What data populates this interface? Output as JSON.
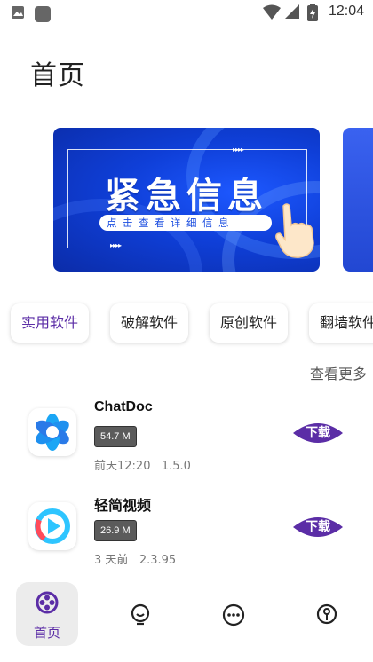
{
  "status_bar": {
    "time": "12:04",
    "left_icons": [
      "image-icon",
      "app-square-icon"
    ],
    "right_icons": [
      "wifi-icon",
      "signal-icon",
      "battery-charging-icon"
    ]
  },
  "page": {
    "title": "首页"
  },
  "banner": {
    "headline": "紧急信息",
    "subtitle": "点击查看详细信息",
    "arrows": "▸▸▸▸"
  },
  "categories": [
    {
      "label": "实用软件",
      "active": true
    },
    {
      "label": "破解软件",
      "active": false
    },
    {
      "label": "原创软件",
      "active": false
    },
    {
      "label": "翻墙软件",
      "active": false
    }
  ],
  "see_more": "查看更多",
  "apps": [
    {
      "name": "ChatDoc",
      "size": "54.7 M",
      "date": "前天12:20",
      "version": "1.5.0",
      "button": "下载",
      "icon": "chatdoc-logo-icon"
    },
    {
      "name": "轻简视频",
      "size": "26.9 M",
      "date": "3 天前",
      "version": "2.3.95",
      "button": "下载",
      "icon": "video-player-logo-icon"
    }
  ],
  "bottom_nav": {
    "home_label": "首页",
    "items": [
      "home-icon",
      "lightbulb-icon",
      "more-dots-icon",
      "profile-icon"
    ]
  },
  "colors": {
    "accent": "#5b2da6",
    "banner_blue": "#1d58ff",
    "size_badge": "#5b5b5b"
  }
}
